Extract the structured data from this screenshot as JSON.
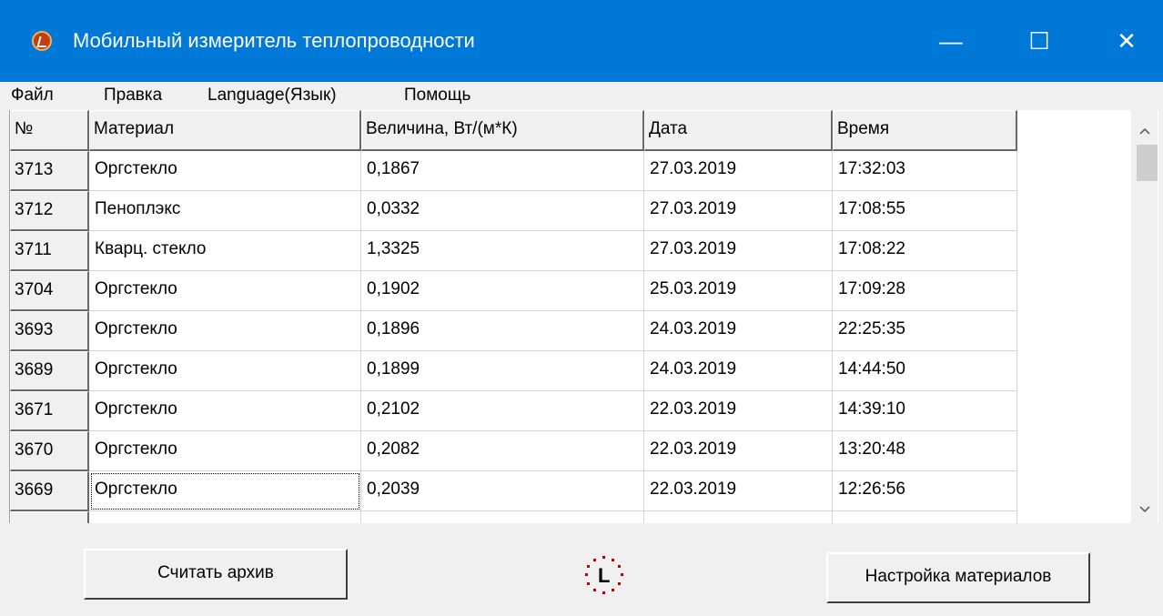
{
  "window": {
    "title": "Мобильный измеритель теплопроводности",
    "minimize": "—",
    "maximize": "☐",
    "close": "✕"
  },
  "menu": [
    "Файл",
    "Правка",
    "Language(Язык)",
    "Помощь"
  ],
  "table": {
    "columns": [
      "№",
      "Материал",
      "Величина, Вт/(м*К)",
      "Дата",
      "Время"
    ],
    "rows": [
      [
        "3713",
        "Оргстекло",
        "0,1867",
        "27.03.2019",
        "17:32:03"
      ],
      [
        "3712",
        "Пеноплэкс",
        "0,0332",
        "27.03.2019",
        "17:08:55"
      ],
      [
        "3711",
        "Кварц. стекло",
        "1,3325",
        "27.03.2019",
        "17:08:22"
      ],
      [
        "3704",
        "Оргстекло",
        "0,1902",
        "25.03.2019",
        "17:09:28"
      ],
      [
        "3693",
        "Оргстекло",
        "0,1896",
        "24.03.2019",
        "22:25:35"
      ],
      [
        "3689",
        "Оргстекло",
        "0,1899",
        "24.03.2019",
        "14:44:50"
      ],
      [
        "3671",
        "Оргстекло",
        "0,2102",
        "22.03.2019",
        "14:39:10"
      ],
      [
        "3670",
        "Оргстекло",
        "0,2082",
        "22.03.2019",
        "13:20:48"
      ],
      [
        "3669",
        "Оргстекло",
        "0,2039",
        "22.03.2019",
        "12:26:56"
      ]
    ],
    "focused_row": 8,
    "focused_col": 1
  },
  "buttons": {
    "read_archive": "Считать архив",
    "material_settings": "Настройка материалов"
  },
  "clock_label": "L",
  "icons": {
    "app": "thermal-meter-app-icon",
    "clock": "clock-icon",
    "scroll_up": "chevron-up-icon",
    "scroll_down": "chevron-down-icon"
  },
  "colors": {
    "titlebar": "#0078d7",
    "window_bg": "#f0f0f0",
    "grid_bg": "#ffffff",
    "clock_dots": "#c00000"
  }
}
